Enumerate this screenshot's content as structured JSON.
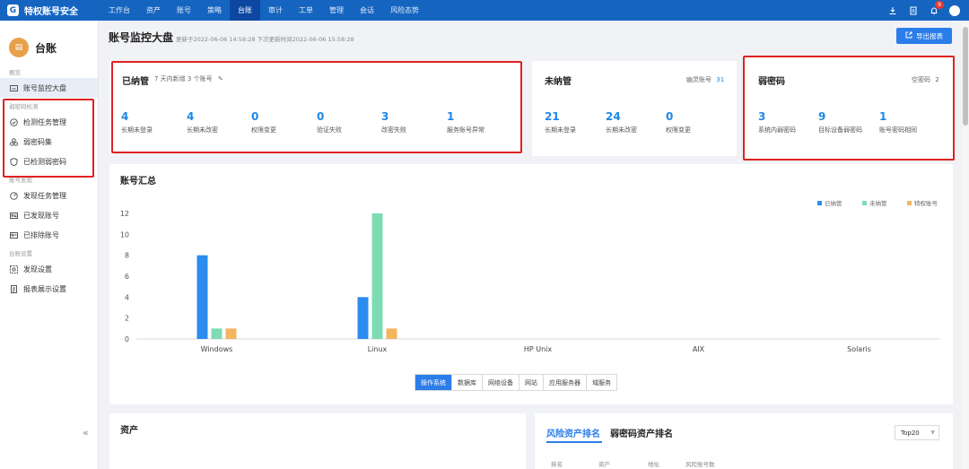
{
  "app": {
    "title": "特权账号安全",
    "logo_char": "G"
  },
  "nav": [
    {
      "label": "工作台"
    },
    {
      "label": "资产"
    },
    {
      "label": "账号"
    },
    {
      "label": "策略"
    },
    {
      "label": "台账",
      "active": true
    },
    {
      "label": "审计"
    },
    {
      "label": "工单"
    },
    {
      "label": "管理"
    },
    {
      "label": "会话"
    },
    {
      "label": "风险态势"
    }
  ],
  "topbar": {
    "notification_count": "9"
  },
  "sidebar": {
    "title": "台账",
    "groups": [
      {
        "label": "概览",
        "items": [
          {
            "label": "账号监控大盘",
            "active": true
          }
        ]
      },
      {
        "label": "弱密码检测",
        "items": [
          {
            "label": "检测任务管理"
          },
          {
            "label": "弱密码集"
          },
          {
            "label": "已检测弱密码"
          }
        ]
      },
      {
        "label": "账号发现",
        "items": [
          {
            "label": "发现任务管理"
          },
          {
            "label": "已发现账号"
          },
          {
            "label": "已排除账号"
          }
        ]
      },
      {
        "label": "台账设置",
        "items": [
          {
            "label": "发现设置"
          },
          {
            "label": "报表展示设置"
          }
        ]
      }
    ],
    "collapse": "«"
  },
  "header": {
    "title": "账号监控大盘",
    "update_info": "更新于2022-06-06 14:58:28 下次更新时间2022-06-06 15:58:28",
    "export_label": "导出报表"
  },
  "managed": {
    "title": "已纳管",
    "subtitle": "7 天内新增 3 个账号",
    "stats": [
      {
        "value": "4",
        "label": "长期未登录"
      },
      {
        "value": "4",
        "label": "长期未改密"
      },
      {
        "value": "0",
        "label": "权限变更"
      },
      {
        "value": "0",
        "label": "验证失败"
      },
      {
        "value": "3",
        "label": "改密失败"
      },
      {
        "value": "1",
        "label": "服务账号异常"
      }
    ]
  },
  "unmanaged": {
    "title": "未纳管",
    "side_label": "幽灵账号",
    "side_value": "31",
    "stats": [
      {
        "value": "21",
        "label": "长期未登录"
      },
      {
        "value": "24",
        "label": "长期未改密"
      },
      {
        "value": "0",
        "label": "权限变更"
      }
    ]
  },
  "weak": {
    "title": "弱密码",
    "side_label": "空密码",
    "side_value": "2",
    "stats": [
      {
        "value": "3",
        "label": "系统内弱密码"
      },
      {
        "value": "9",
        "label": "目标设备弱密码"
      },
      {
        "value": "1",
        "label": "账号密码相同"
      }
    ]
  },
  "summary": {
    "title": "账号汇总",
    "tabs": [
      {
        "label": "操作系统",
        "active": true
      },
      {
        "label": "数据库"
      },
      {
        "label": "网络设备"
      },
      {
        "label": "网站"
      },
      {
        "label": "应用服务器"
      },
      {
        "label": "域服务"
      }
    ]
  },
  "chart_data": {
    "type": "bar",
    "title": "账号汇总",
    "categories": [
      "Windows",
      "Linux",
      "HP Unix",
      "AIX",
      "Solaris"
    ],
    "series": [
      {
        "name": "已纳管",
        "color": "#2b8cf0",
        "values": [
          8,
          4,
          0,
          0,
          0
        ]
      },
      {
        "name": "未纳管",
        "color": "#7ddcb4",
        "values": [
          1,
          12,
          0,
          0,
          0
        ]
      },
      {
        "name": "特权账号",
        "color": "#f5b45f",
        "values": [
          1,
          1,
          0,
          0,
          0
        ]
      }
    ],
    "yticks": [
      0,
      2,
      4,
      6,
      8,
      10,
      12
    ],
    "ylim": [
      0,
      12
    ],
    "legend": "top-right",
    "grid": false
  },
  "assets": {
    "title": "资产"
  },
  "ranking": {
    "tabs": [
      {
        "label": "风险资产排名",
        "active": true
      },
      {
        "label": "弱密码资产排名"
      }
    ],
    "select_value": "Top20",
    "columns": [
      "排名",
      "资产",
      "地址",
      "风险账号数"
    ]
  }
}
